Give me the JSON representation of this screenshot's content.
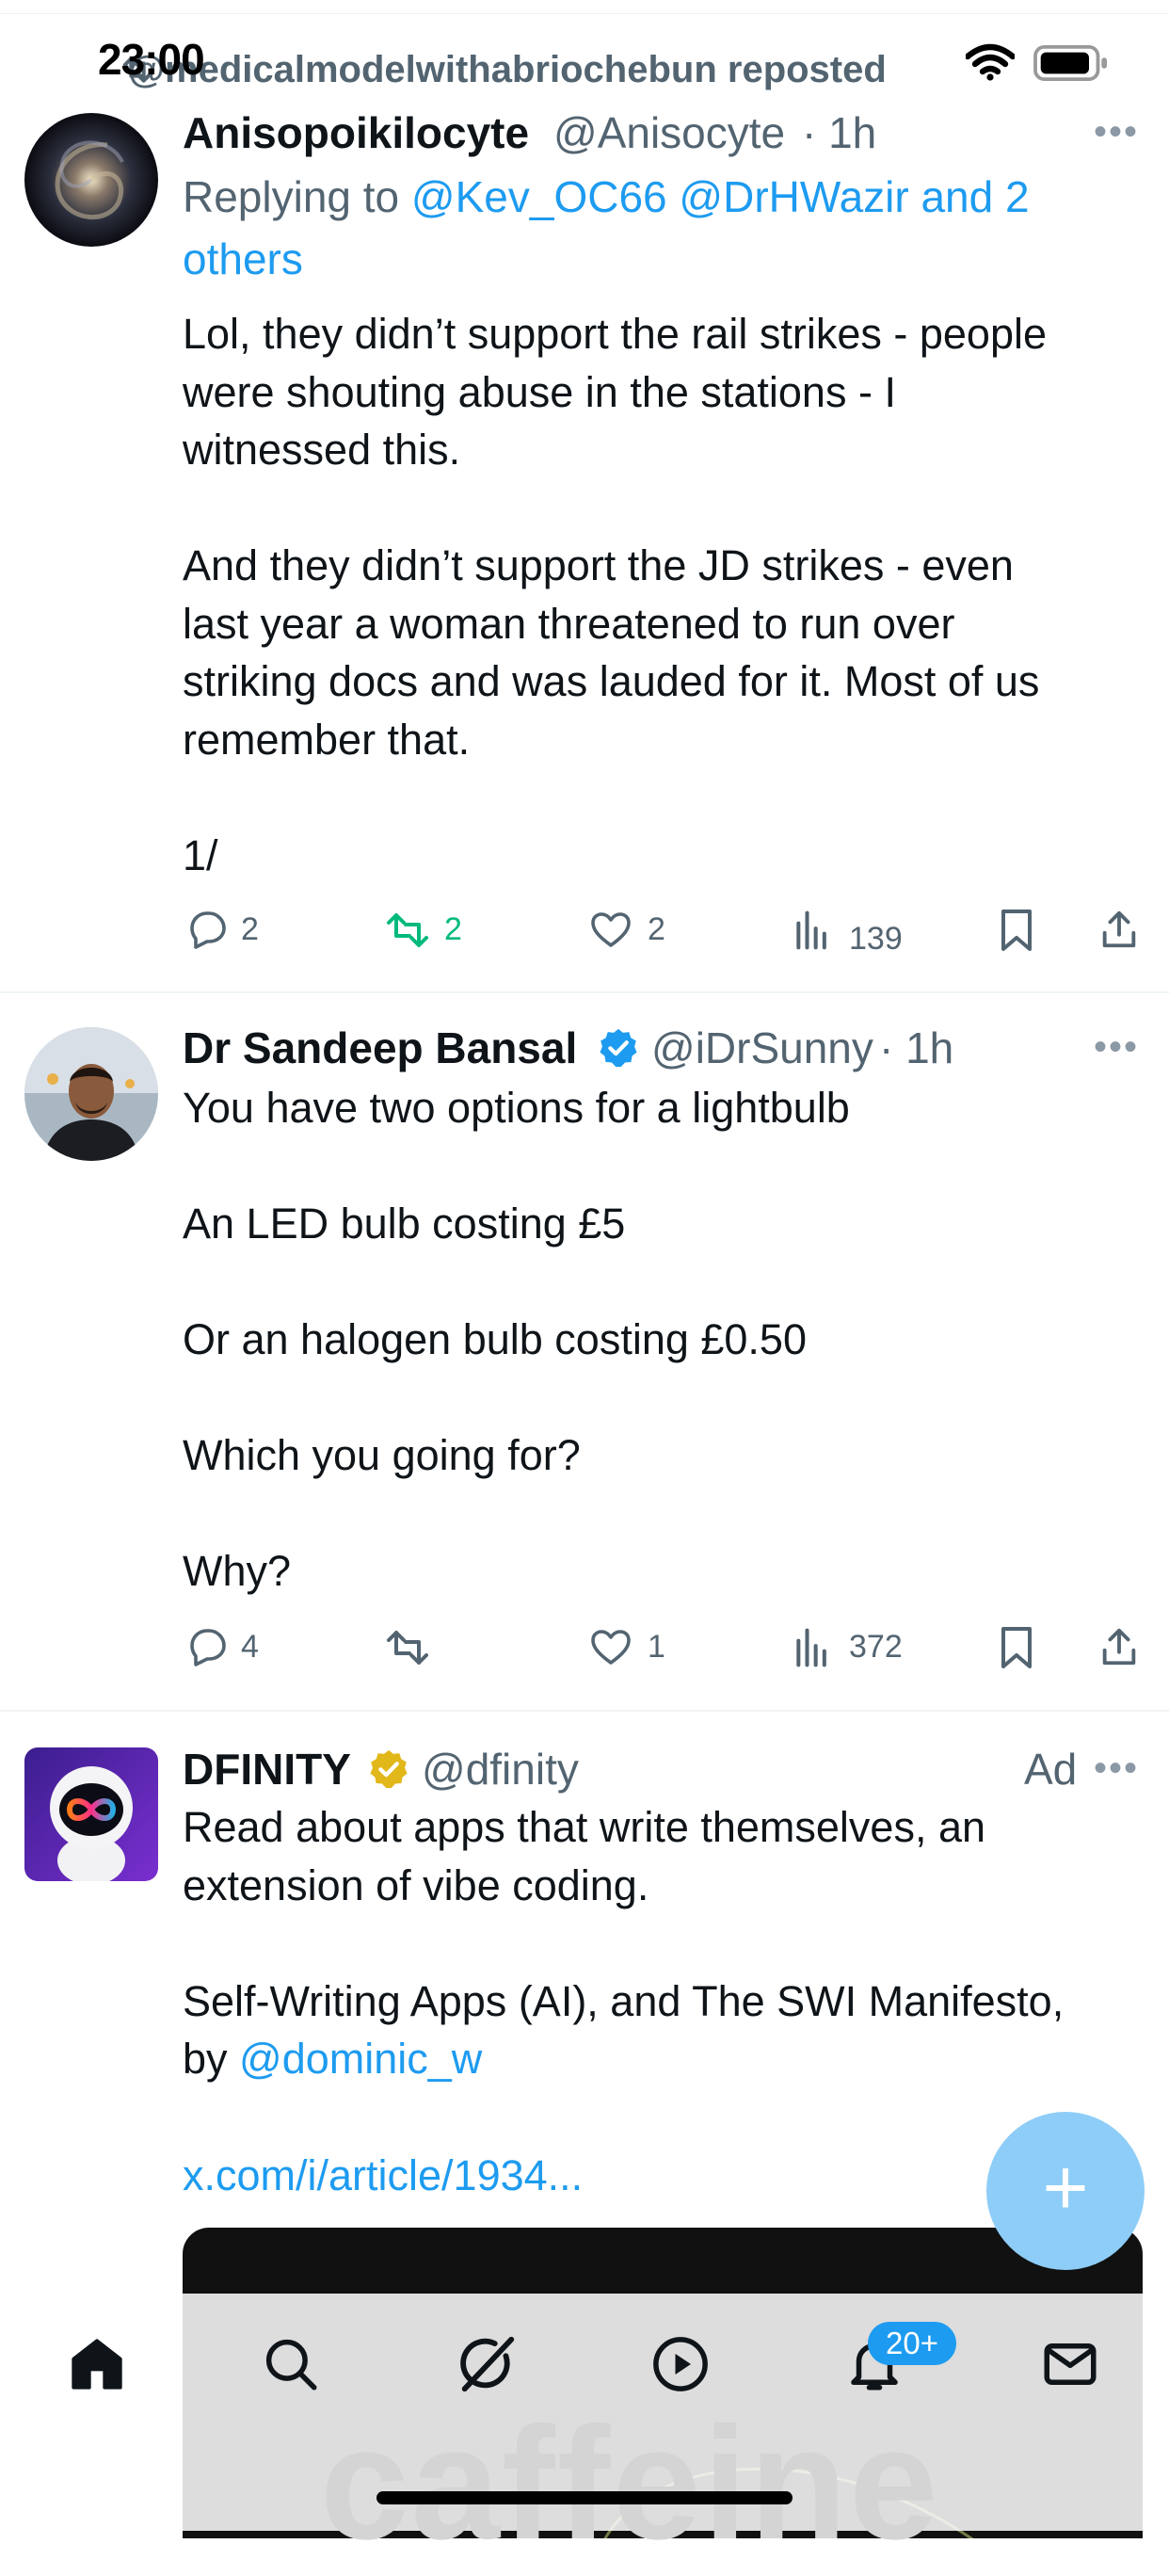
{
  "status_bar": {
    "time": "23:00"
  },
  "repost_banner": {
    "text": "@medicalmodelwithabriochebun reposted"
  },
  "posts": [
    {
      "name": "Anisopoikilocyte",
      "handle": "@Anisocyte",
      "time": "· 1h",
      "reply_prefix": "Replying to ",
      "reply_targets_line1": "@Kev_OC66 @DrHWazir and 2",
      "reply_targets_line2": "others",
      "text": "Lol, they didn’t support the rail strikes - people\nwere shouting abuse in the stations - I\nwitnessed this.\n\nAnd they didn’t support the JD strikes - even\nlast year a woman threatened to run over\nstriking docs and was lauded for it. Most of us\nremember that.\n\n1/",
      "replies": "2",
      "reposts": "2",
      "likes": "2",
      "views": "139"
    },
    {
      "name": "Dr Sandeep Bansal",
      "handle": "@iDrSunny",
      "time": "· 1h",
      "text": "You have two options for a lightbulb\n\nAn LED bulb costing £5\n\nOr an halogen bulb costing £0.50\n\nWhich you going for?\n\nWhy?",
      "replies": "4",
      "reposts": "",
      "likes": "1",
      "views": "372"
    },
    {
      "name": "DFINITY",
      "handle": "@dfinity",
      "ad_label": "Ad",
      "text_part1": "Read about apps that write themselves, an\nextension of vibe coding.\n\nSelf-Writing Apps (AI), and The SWI Manifesto,\nby ",
      "mention": "@dominic_w",
      "link": "x.com/i/article/1934...",
      "media_text": "caffeine"
    }
  ],
  "nav": {
    "notification_badge": "20+",
    "icons": [
      "home-icon",
      "search-icon",
      "grok-icon",
      "video-icon",
      "notifications-icon",
      "messages-icon"
    ]
  },
  "fab": {
    "label": "+"
  },
  "colors": {
    "accent": "#1d9bf0",
    "repost_green": "#00ba7c",
    "muted": "#536471",
    "verified_blue": "#1d9bf0",
    "verified_gold": "#e2b719"
  }
}
